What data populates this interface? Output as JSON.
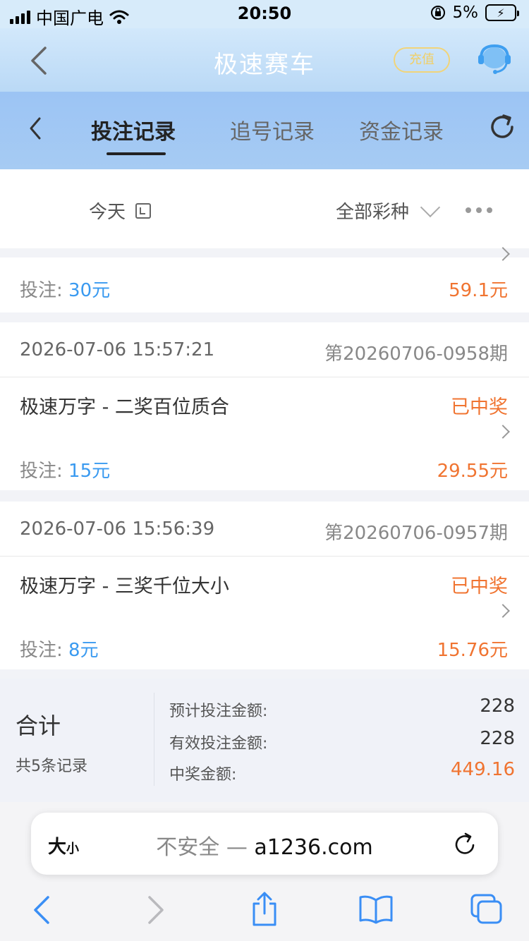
{
  "status_bar": {
    "carrier": "中国广电",
    "time": "20:50",
    "battery": "5%"
  },
  "header": {
    "title": "极速赛车",
    "recharge": "充值"
  },
  "tabs": [
    {
      "label": "投注记录",
      "active": true
    },
    {
      "label": "追号记录",
      "active": false
    },
    {
      "label": "资金记录",
      "active": false
    }
  ],
  "filter": {
    "date": "今天",
    "lottery": "全部彩种"
  },
  "partial_record": {
    "bet_label": "投注:",
    "bet": "30元",
    "win": "59.1元"
  },
  "records": [
    {
      "datetime": "2026-07-06 15:57:21",
      "issue": "第20260706-0958期",
      "name": "极速万字 - 二奖百位质合",
      "status": "已中奖",
      "bet_label": "投注:",
      "bet": "15元",
      "win": "29.55元"
    },
    {
      "datetime": "2026-07-06 15:56:39",
      "issue": "第20260706-0957期",
      "name": "极速万字 - 三奖千位大小",
      "status": "已中奖",
      "bet_label": "投注:",
      "bet": "8元",
      "win": "15.76元"
    }
  ],
  "summary": {
    "title": "合计",
    "count": "共5条记录",
    "rows": [
      {
        "label": "预计投注金额:",
        "value": "228"
      },
      {
        "label": "有效投注金额:",
        "value": "228"
      },
      {
        "label": "中奖金额:",
        "value": "449.16"
      }
    ]
  },
  "browser": {
    "text_size_big": "大",
    "text_size_small": "小",
    "insecure": "不安全 — ",
    "host": "a1236.com"
  },
  "colors": {
    "accent_blue": "#3a9af0",
    "win_orange": "#f07431",
    "header_blue": "#a6cbf3"
  }
}
